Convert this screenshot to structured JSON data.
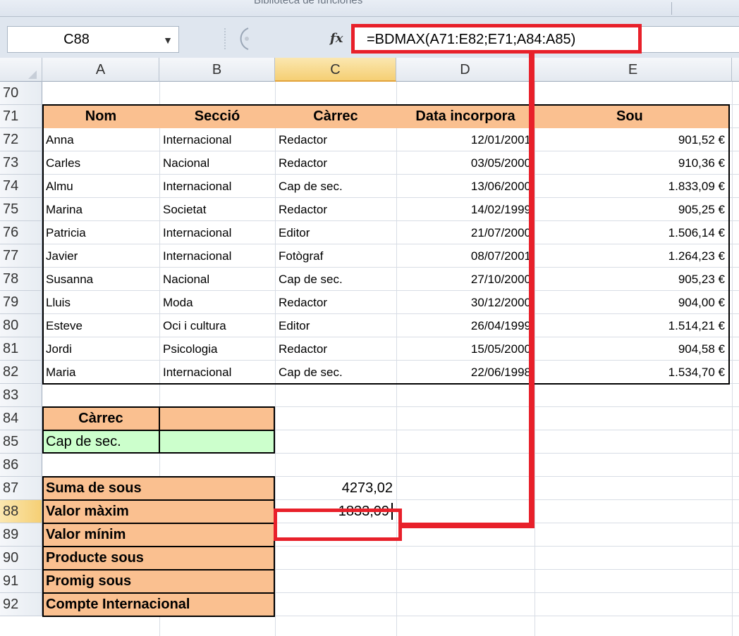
{
  "ribbon": {
    "group_label": "Biblioteca de funciones"
  },
  "formula_bar": {
    "name_box": "C88",
    "name_box_dropdown": "▼",
    "fx_label": "fx",
    "formula": "=BDMAX(A71:E82;E71;A84:A85)"
  },
  "columns": [
    "A",
    "B",
    "C",
    "D",
    "E"
  ],
  "selected_column": "C",
  "rows": [
    "70",
    "71",
    "72",
    "73",
    "74",
    "75",
    "76",
    "77",
    "78",
    "79",
    "80",
    "81",
    "82",
    "83",
    "84",
    "85",
    "86",
    "87",
    "88",
    "89",
    "90",
    "91",
    "92"
  ],
  "selected_row": "88",
  "table": {
    "headers": [
      "Nom",
      "Secció",
      "Càrrec",
      "Data incorpora",
      "Sou"
    ],
    "records": [
      [
        "Anna",
        "Internacional",
        "Redactor",
        "12/01/2001",
        "901,52 €"
      ],
      [
        "Carles",
        "Nacional",
        "Redactor",
        "03/05/2000",
        "910,36 €"
      ],
      [
        "Almu",
        "Internacional",
        "Cap de sec.",
        "13/06/2000",
        "1.833,09 €"
      ],
      [
        "Marina",
        "Societat",
        "Redactor",
        "14/02/1999",
        "905,25 €"
      ],
      [
        "Patricia",
        "Internacional",
        "Editor",
        "21/07/2000",
        "1.506,14 €"
      ],
      [
        "Javier",
        "Internacional",
        "Fotògraf",
        "08/07/2001",
        "1.264,23 €"
      ],
      [
        "Susanna",
        "Nacional",
        "Cap de sec.",
        "27/10/2000",
        "905,23 €"
      ],
      [
        "Lluis",
        "Moda",
        "Redactor",
        "30/12/2000",
        "904,00 €"
      ],
      [
        "Esteve",
        "Oci i cultura",
        "Editor",
        "26/04/1999",
        "1.514,21 €"
      ],
      [
        "Jordi",
        "Psicologia",
        "Redactor",
        "15/05/2000",
        "904,58 €"
      ],
      [
        "Maria",
        "Internacional",
        "Cap de sec.",
        "22/06/1998",
        "1.534,70 €"
      ]
    ]
  },
  "criteria": {
    "header": "Càrrec",
    "value": "Cap de sec."
  },
  "summary": [
    {
      "label": "Suma de sous",
      "value": "4273,02"
    },
    {
      "label": "Valor màxim",
      "value": "1833,09"
    },
    {
      "label": "Valor mínim",
      "value": ""
    },
    {
      "label": "Producte sous",
      "value": ""
    },
    {
      "label": "Promig sous",
      "value": ""
    },
    {
      "label": "Compte Internacional",
      "value": ""
    }
  ],
  "colors": {
    "header_fill": "#fac090",
    "criteria_fill": "#ccffcc",
    "highlight_red": "#e8202a",
    "selection_orange": "#f5cf74"
  }
}
